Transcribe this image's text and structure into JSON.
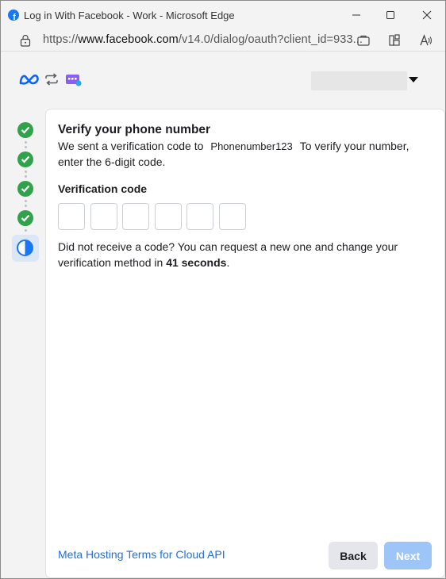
{
  "window": {
    "title": "Log in With Facebook - Work - Microsoft Edge"
  },
  "addressbar": {
    "url_prefix": "https://",
    "url_domain": "www.facebook.com",
    "url_rest": "/v14.0/dialog/oauth?client_id=933..."
  },
  "colors": {
    "brand": "#1877f2",
    "success": "#31a24c",
    "link": "#216fdb",
    "next_disabled": "#9ec5f8"
  },
  "icons": {
    "favicon": "facebook-icon",
    "meta": "meta-logo-icon",
    "sync": "sync-arrows-icon",
    "app": "app-icon",
    "lock": "lock-icon",
    "tab": "tab-icon",
    "extensions": "extensions-icon",
    "read_aloud": "read-aloud-icon",
    "dropdown": "caret-down-icon"
  },
  "steps": [
    {
      "state": "done"
    },
    {
      "state": "done"
    },
    {
      "state": "done"
    },
    {
      "state": "done"
    },
    {
      "state": "current"
    }
  ],
  "main": {
    "heading": "Verify your phone number",
    "desc_before": "We sent a verification code to",
    "phone": "Phonenumber123",
    "desc_after": "To verify your number, enter the 6-digit code.",
    "code_label": "Verification code",
    "code_digits": [
      "",
      "",
      "",
      "",
      "",
      ""
    ],
    "resend_text": "Did not receive a code? You can request a new one and change your verification method in",
    "resend_countdown": "41 seconds",
    "resend_end": "."
  },
  "footer": {
    "terms_link": "Meta Hosting Terms for Cloud API",
    "back_label": "Back",
    "next_label": "Next"
  }
}
